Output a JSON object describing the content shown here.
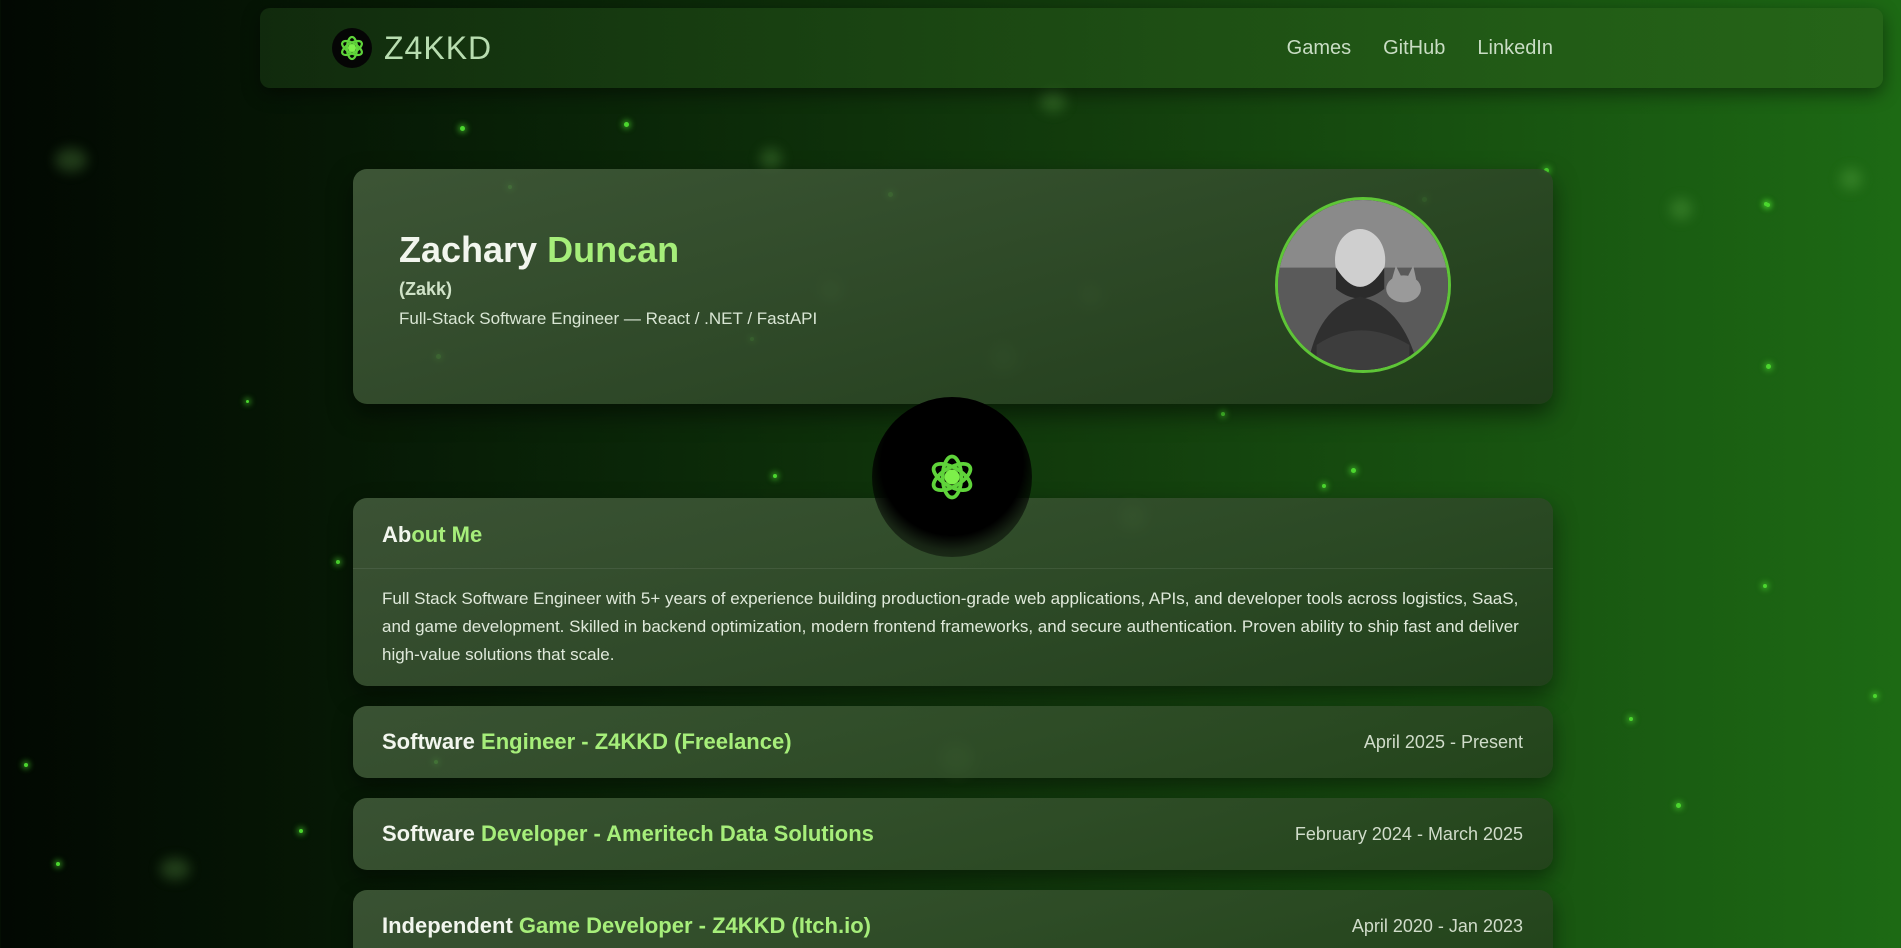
{
  "nav": {
    "brand": "Z4KKD",
    "links": [
      "Games",
      "GitHub",
      "LinkedIn"
    ]
  },
  "hero": {
    "first_name": "Zachary",
    "last_name": "Duncan",
    "nickname": "(Zakk)",
    "title": "Full-Stack Software Engineer — React / .NET / FastAPI"
  },
  "about": {
    "title_plain": "Ab",
    "title_accent": "out Me",
    "text": "Full Stack Software Engineer with 5+ years of experience building production-grade web applications, APIs, and developer tools across logistics, SaaS, and game development. Skilled in backend optimization, modern frontend frameworks, and secure authentication. Proven ability to ship fast and deliver high-value solutions that scale."
  },
  "jobs": [
    {
      "title_plain": "Software ",
      "title_accent": "Engineer - Z4KKD (Freelance)",
      "date": "April 2025 - Present"
    },
    {
      "title_plain": "Software ",
      "title_accent": "Developer - Ameritech Data Solutions",
      "date": "February 2024 - March 2025"
    },
    {
      "title_plain": "Independent ",
      "title_accent": "Game Developer - Z4KKD (Itch.io)",
      "date": "April 2020 - Jan 2023"
    }
  ],
  "colors": {
    "accent": "#a6ee7a",
    "bg_dark": "#020802",
    "bg_light": "#1d6a14",
    "avatar_border": "#5ec537"
  },
  "icons": {
    "brand_logo": "z4kkd-logo-icon",
    "center_badge": "z4kkd-logo-icon"
  }
}
